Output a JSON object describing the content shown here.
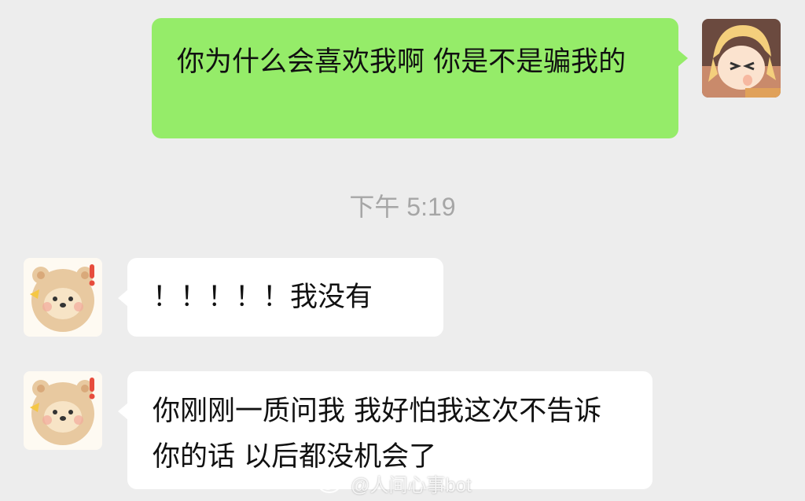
{
  "timestamp": "下午 5:19",
  "messages": [
    {
      "side": "outgoing",
      "text": "你为什么会喜欢我啊 你是不是骗我的",
      "avatar": "anime-girl-avatar"
    },
    {
      "side": "incoming",
      "text": "！！！！！我没有",
      "avatar": "bear-sticker-avatar"
    },
    {
      "side": "incoming",
      "text": "你刚刚一质问我 我好怕我这次不告诉你的话 以后都没机会了",
      "avatar": "bear-sticker-avatar"
    }
  ],
  "watermark": {
    "text": "@人间心事bot",
    "icon": "weibo-icon"
  },
  "colors": {
    "background": "#ededed",
    "outgoing_bubble": "#95ec69",
    "incoming_bubble": "#ffffff",
    "timestamp_text": "#a6a6a6"
  }
}
